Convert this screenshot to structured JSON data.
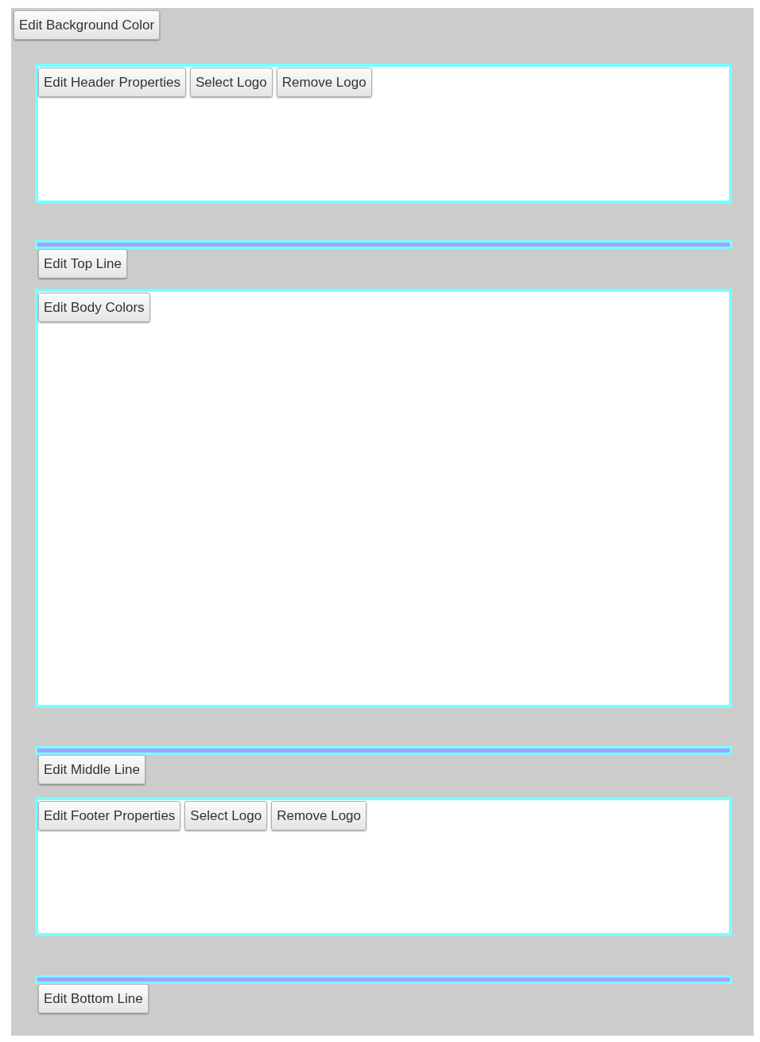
{
  "toolbar": {
    "buttons": [
      "Edit Background Color"
    ]
  },
  "sections": [
    {
      "kind": "header",
      "buttons": [
        "Edit Header Properties",
        "Select Logo",
        "Remove Logo"
      ]
    },
    {
      "kind": "line",
      "buttons": [
        "Edit Top Line"
      ]
    },
    {
      "kind": "body",
      "buttons": [
        "Edit Body Colors"
      ]
    },
    {
      "kind": "line",
      "buttons": [
        "Edit Middle Line"
      ]
    },
    {
      "kind": "footer",
      "buttons": [
        "Edit Footer Properties",
        "Select Logo",
        "Remove Logo"
      ]
    },
    {
      "kind": "line",
      "buttons": [
        "Edit Bottom Line"
      ]
    }
  ]
}
